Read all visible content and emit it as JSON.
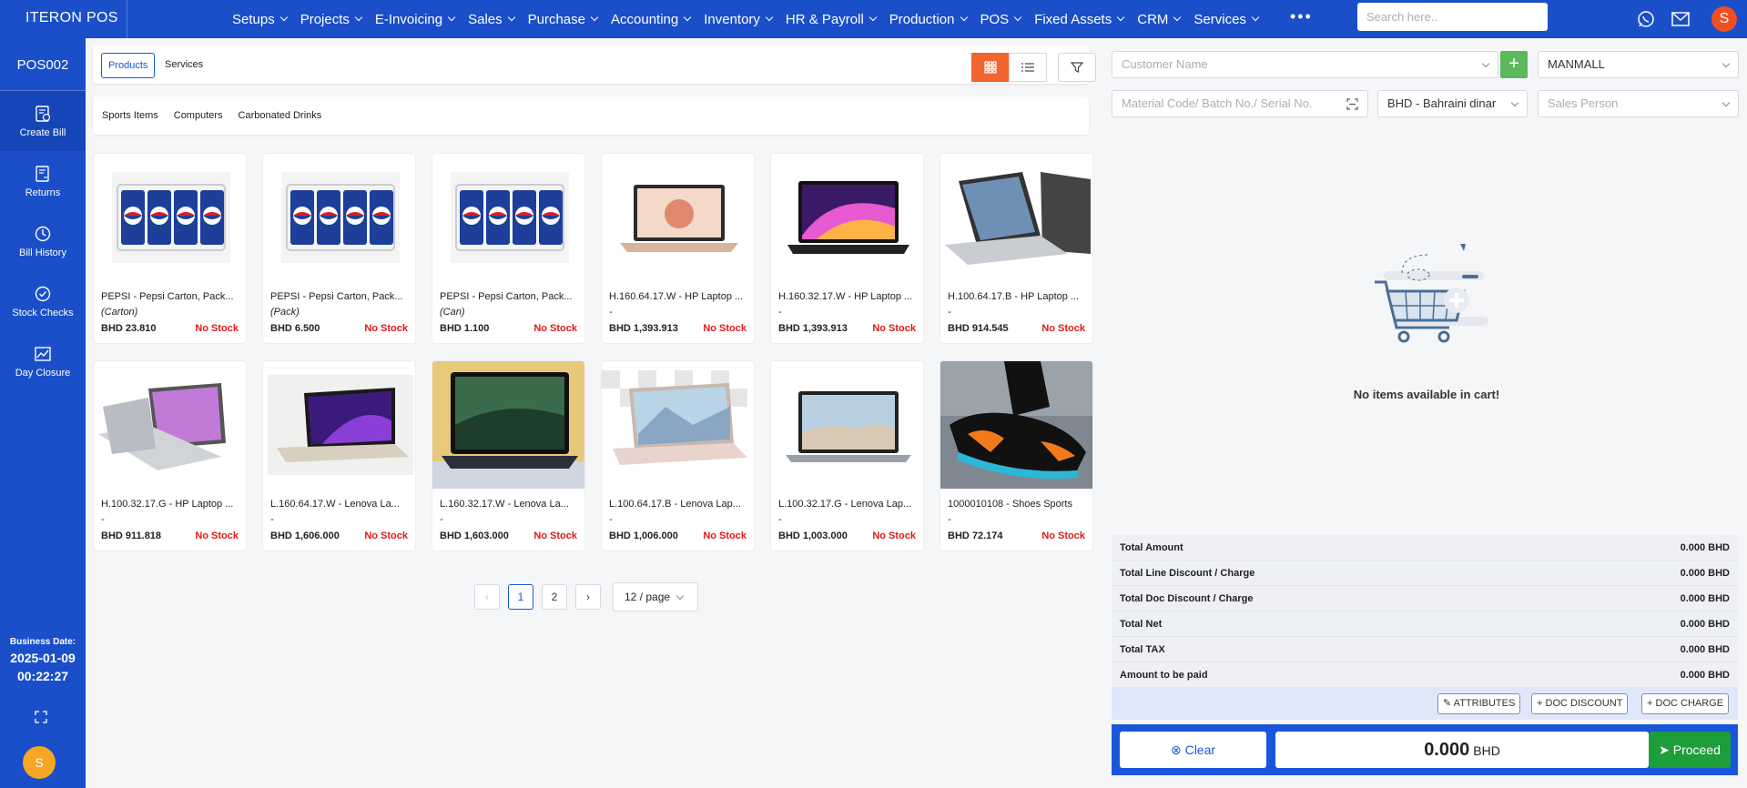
{
  "app": {
    "brand": "ITERON POS",
    "user_initial": "S"
  },
  "nav": {
    "items": [
      "Setups",
      "Projects",
      "E-Invoicing",
      "Sales",
      "Purchase",
      "Accounting",
      "Inventory",
      "HR & Payroll",
      "Production",
      "POS",
      "Fixed Assets",
      "CRM",
      "Services"
    ],
    "more": "•••",
    "search_placeholder": "Search here..",
    "icons": [
      "whatsapp-icon",
      "mail-icon"
    ]
  },
  "sidebar": {
    "pos_id": "POS002",
    "items": [
      {
        "label": "Create Bill",
        "icon": "create-bill-icon"
      },
      {
        "label": "Returns",
        "icon": "returns-icon"
      },
      {
        "label": "Bill History",
        "icon": "history-icon"
      },
      {
        "label": "Stock Checks",
        "icon": "check-icon"
      },
      {
        "label": "Day Closure",
        "icon": "chart-icon"
      }
    ],
    "business_date_label": "Business Date:",
    "business_date": "2025-01-09",
    "business_time": "00:22:27",
    "user_initial": "S"
  },
  "main": {
    "tabs": [
      "Products",
      "Services"
    ],
    "categories": [
      "Sports Items",
      "Computers",
      "Carbonated Drinks"
    ],
    "products": [
      {
        "name": "PEPSI - Pepsi Carton, Pack...",
        "unit": "(Carton)",
        "price": "BHD 23.810",
        "stock": "No Stock",
        "image": "pepsi"
      },
      {
        "name": "PEPSI - Pepsi Carton, Pack...",
        "unit": "(Pack)",
        "price": "BHD 6.500",
        "stock": "No Stock",
        "image": "pepsi"
      },
      {
        "name": "PEPSI - Pepsi Carton, Pack...",
        "unit": "(Can)",
        "price": "BHD 1.100",
        "stock": "No Stock",
        "image": "pepsi"
      },
      {
        "name": "H.160.64.17.W - HP Laptop ...",
        "unit": "-",
        "price": "BHD 1,393.913",
        "stock": "No Stock",
        "image": "laptop-gold"
      },
      {
        "name": "H.160.32.17.W - HP Laptop ...",
        "unit": "-",
        "price": "BHD 1,393.913",
        "stock": "No Stock",
        "image": "laptop-dark"
      },
      {
        "name": "H.100.64.17.B - HP Laptop ...",
        "unit": "-",
        "price": "BHD 914.545",
        "stock": "No Stock",
        "image": "laptop-silver"
      },
      {
        "name": "H.100.32.17.G - HP Laptop ...",
        "unit": "-",
        "price": "BHD 911.818",
        "stock": "No Stock",
        "image": "laptop-silver2"
      },
      {
        "name": "L.160.64.17.W - Lenova La...",
        "unit": "-",
        "price": "BHD 1,606.000",
        "stock": "No Stock",
        "image": "laptop-purple"
      },
      {
        "name": "L.160.32.17.W - Lenova La...",
        "unit": "-",
        "price": "BHD 1,603.000",
        "stock": "No Stock",
        "image": "laptop-green"
      },
      {
        "name": "L.100.64.17.B - Lenova Lap...",
        "unit": "-",
        "price": "BHD 1,006.000",
        "stock": "No Stock",
        "image": "laptop-pink"
      },
      {
        "name": "L.100.32.17.G - Lenova Lap...",
        "unit": "-",
        "price": "BHD 1,003.000",
        "stock": "No Stock",
        "image": "laptop-gray"
      },
      {
        "name": "1000010108 - Shoes Sports",
        "unit": "-",
        "price": "BHD 72.174",
        "stock": "No Stock",
        "image": "shoe"
      }
    ],
    "pagination": {
      "pages": [
        "1",
        "2"
      ],
      "current": "1",
      "per_page": "12 / page"
    }
  },
  "cart": {
    "customer_placeholder": "Customer Name",
    "store": "MANMALL",
    "material_placeholder": "Material Code/ Batch No./ Serial No.",
    "currency": "BHD - Bahraini dinar",
    "sales_person_placeholder": "Sales Person",
    "empty_message": "No items available in cart!",
    "totals": [
      {
        "label": "Total Amount",
        "value": "0.000 BHD"
      },
      {
        "label": "Total Line Discount / Charge",
        "value": "0.000 BHD"
      },
      {
        "label": "Total Doc Discount / Charge",
        "value": "0.000 BHD"
      },
      {
        "label": "Total Net",
        "value": "0.000 BHD"
      },
      {
        "label": "Total TAX",
        "value": "0.000 BHD"
      },
      {
        "label": "Amount to be paid",
        "value": "0.000 BHD"
      }
    ],
    "actions": [
      "ATTRIBUTES",
      "DOC DISCOUNT",
      "DOC CHARGE"
    ],
    "clear_label": "Clear",
    "amount": "0.000",
    "amount_currency": "BHD",
    "proceed_label": "Proceed"
  },
  "colors": {
    "brand": "#1a4fc9",
    "accent": "#f26430",
    "success": "#1e9e3a",
    "danger": "#e01818"
  }
}
